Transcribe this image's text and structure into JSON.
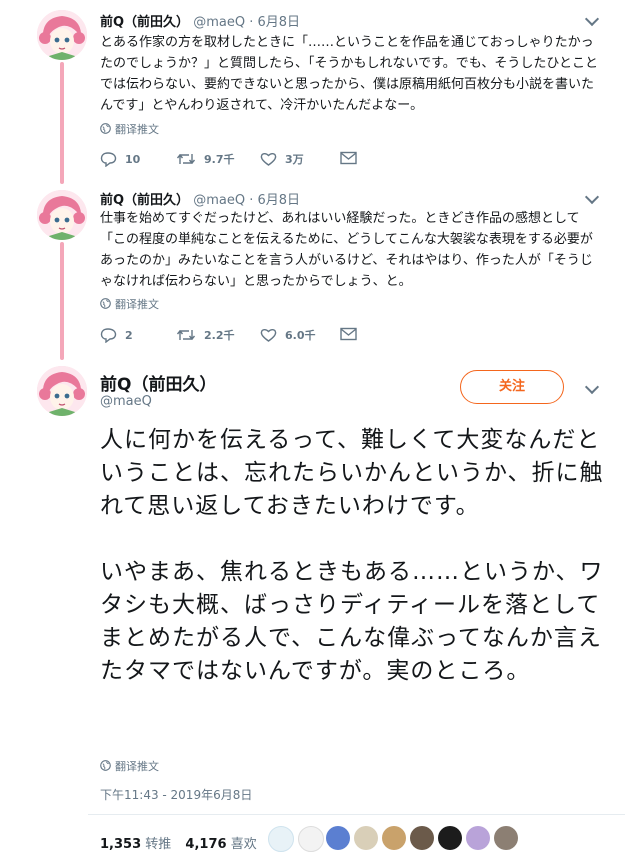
{
  "tweets": [
    {
      "name": "前Q（前田久）",
      "handle": "@maeQ",
      "sep": "·",
      "date": "6月8日",
      "text": "とある作家の方を取材したときに「……ということを作品を通じておっしゃりたかったのでしょうか？」と質問したら、「そうかもしれないです。でも、そうしたひとことでは伝わらない、要約できないと思ったから、僕は原稿用紙何百枚分も小説を書いたんです」とやんわり返されて、冷汗かいたんだよなー。",
      "translate": "翻译推文",
      "replies": "10",
      "retweets": "9.7千",
      "likes": "3万"
    },
    {
      "name": "前Q（前田久）",
      "handle": "@maeQ",
      "sep": "·",
      "date": "6月8日",
      "text": "仕事を始めてすぐだったけど、あれはいい経験だった。ときどき作品の感想として「この程度の単純なことを伝えるために、どうしてこんな大袈裟な表現をする必要があったのか」みたいなことを言う人がいるけど、それはやはり、作った人が「そうじゃなければ伝わらない」と思ったからでしょう、と。",
      "translate": "翻译推文",
      "replies": "2",
      "retweets": "2.2千",
      "likes": "6.0千"
    }
  ],
  "main": {
    "name": "前Q（前田久）",
    "handle": "@maeQ",
    "follow_label": "关注",
    "text": "人に何かを伝えるって、難しくて大変なんだということは、忘れたらいかんというか、折に触れて思い返しておきたいわけです。\n\nいやまあ、焦れるときもある……というか、ワタシも大概、ばっさりディティールを落としてまとめたがる人で、こんな偉ぶってなんか言えたタマではないんですが。実のところ。",
    "translate": "翻译推文",
    "timestamp": "下午11:43 - 2019年6月8日",
    "retweet_count": "1,353",
    "retweet_label": "转推",
    "like_count": "4,176",
    "like_label": "喜欢"
  },
  "colors": {
    "thread_line": "#f4a7b9",
    "follow": "#f4661d",
    "secondary": "#657786"
  },
  "icons": [
    "chevron-down-icon",
    "globe-icon",
    "reply-icon",
    "retweet-icon",
    "heart-icon",
    "mail-icon"
  ]
}
